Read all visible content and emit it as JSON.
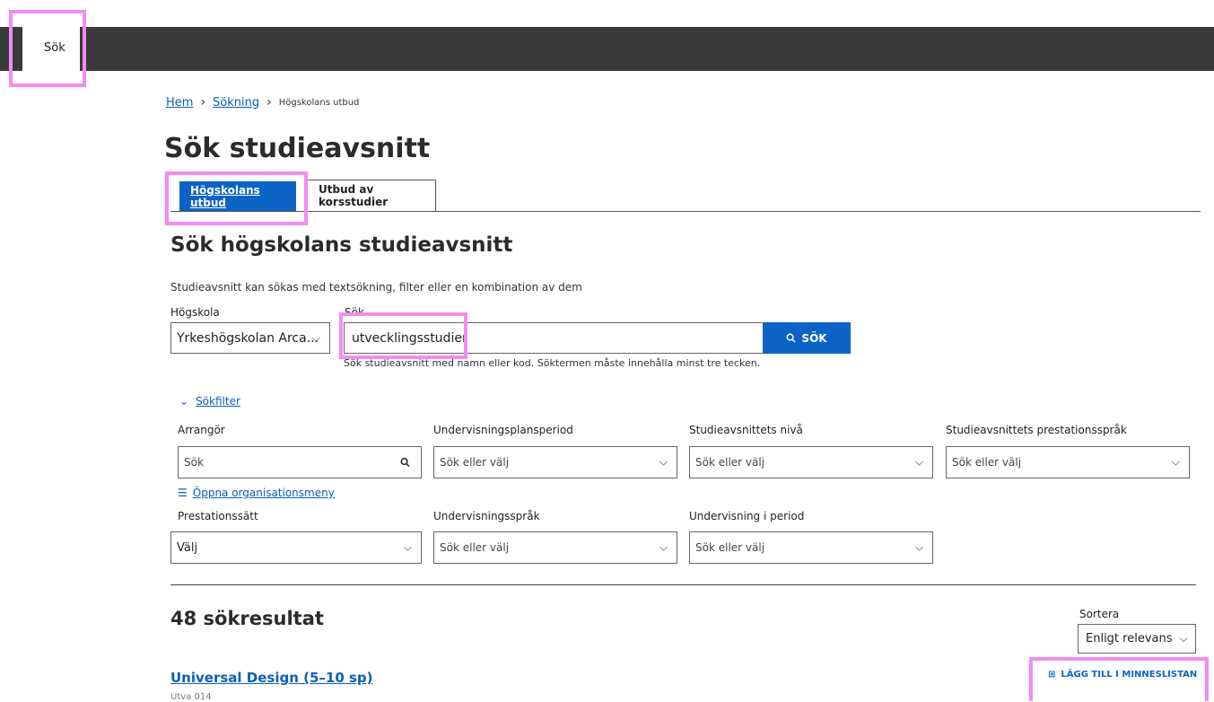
{
  "topbar": {
    "tab_label": "Sök"
  },
  "breadcrumb": {
    "home": "Hem",
    "search": "Sökning",
    "current": "Högskolans utbud"
  },
  "page": {
    "title": "Sök studieavsnitt"
  },
  "tabs": [
    {
      "label": "Högskolans utbud",
      "active": true
    },
    {
      "label": "Utbud av korsstudier",
      "active": false
    }
  ],
  "section": {
    "title": "Sök högskolans studieavsnitt",
    "description": "Studieavsnitt kan sökas med textsökning, filter eller en kombination av dem"
  },
  "search": {
    "school_label": "Högskola",
    "school_value": "Yrkeshögskolan Arca...",
    "search_label": "Sök",
    "search_value": "utvecklingsstudier",
    "button_label": "SÖK",
    "helper": "Sök studieavsnitt med namn eller kod. Söktermen måste innehålla minst tre tecken."
  },
  "filters": {
    "toggle_label": "Sökfilter",
    "arranger_label": "Arrangör",
    "arranger_placeholder": "Sök",
    "org_menu_label": "Öppna organisationsmeny",
    "period_label": "Undervisningsplansperiod",
    "period_placeholder": "Sök eller välj",
    "level_label": "Studieavsnittets nivå",
    "level_placeholder": "Sök eller välj",
    "lang_label": "Studieavsnittets prestationsspråk",
    "lang_placeholder": "Sök eller välj",
    "method_label": "Prestationssätt",
    "method_value": "Välj",
    "teach_lang_label": "Undervisningsspråk",
    "teach_lang_placeholder": "Sök eller välj",
    "teach_period_label": "Undervisning i period",
    "teach_period_placeholder": "Sök eller välj"
  },
  "results": {
    "count_label": "48 sökresultat",
    "sort_label": "Sortera",
    "sort_value": "Enligt relevans",
    "first_title": "Universal Design (5–10 sp)",
    "first_sub": "Utva 014",
    "add_to_memory": "LÄGG TILL I MINNESLISTAN"
  },
  "colors": {
    "accent": "#0b64c5",
    "highlight": "#f28cf2",
    "topbar": "#3a3a3a"
  }
}
